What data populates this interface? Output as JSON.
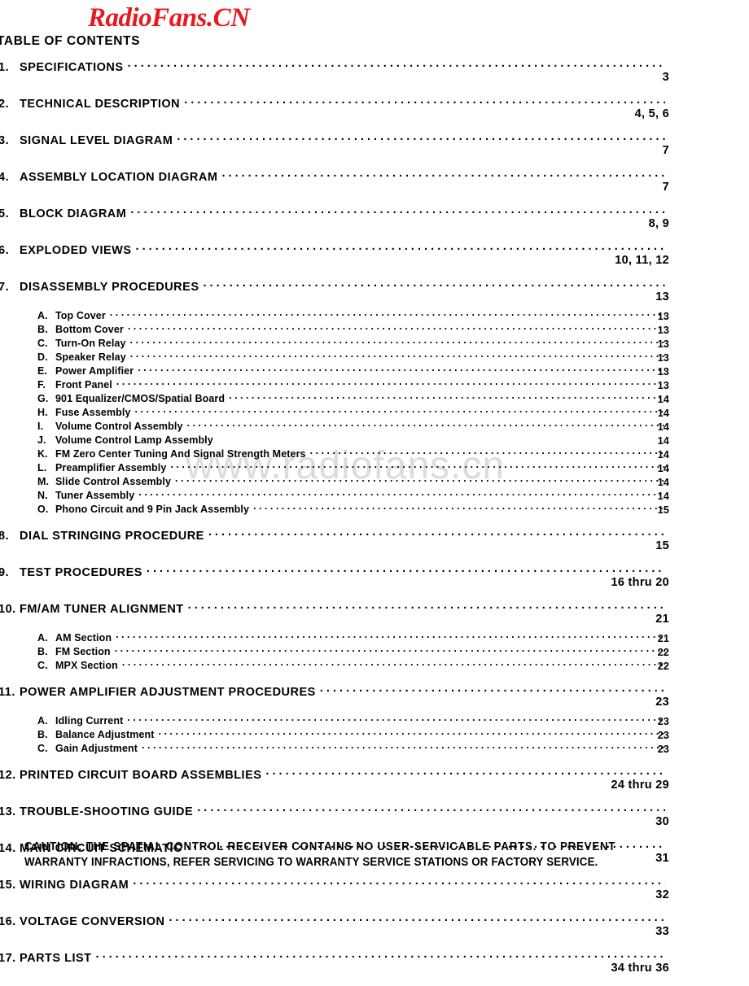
{
  "logo": {
    "text": "RadioFans.CN",
    "color": "#e8191e"
  },
  "watermark": {
    "text": "www.radiofans.cn",
    "color": "#dcdcdc"
  },
  "heading": "TABLE OF CONTENTS",
  "entries": [
    {
      "num": "1.",
      "label": "SPECIFICATIONS",
      "pages": "3",
      "level": "major",
      "leader": true,
      "gap": "md"
    },
    {
      "num": "2.",
      "label": "TECHNICAL DESCRIPTION",
      "pages": "4, 5, 6",
      "level": "major",
      "leader": true,
      "gap": "md"
    },
    {
      "num": "3.",
      "label": "SIGNAL LEVEL DIAGRAM",
      "pages": "7",
      "level": "major",
      "leader": true,
      "gap": "md"
    },
    {
      "num": "4.",
      "label": "ASSEMBLY LOCATION DIAGRAM",
      "pages": "7",
      "level": "major",
      "leader": true,
      "gap": "md"
    },
    {
      "num": "5.",
      "label": "BLOCK DIAGRAM",
      "pages": "8, 9",
      "level": "major",
      "leader": true,
      "gap": "md"
    },
    {
      "num": "6.",
      "label": "EXPLODED VIEWS",
      "pages": "10, 11, 12",
      "level": "major",
      "leader": true,
      "gap": "md"
    },
    {
      "num": "7.",
      "label": "DISASSEMBLY PROCEDURES",
      "pages": "13",
      "level": "major",
      "leader": true,
      "gap": "sm"
    },
    {
      "num": "A.",
      "label": "Top Cover",
      "pages": "13",
      "level": "sub",
      "leader": true
    },
    {
      "num": "B.",
      "label": "Bottom Cover",
      "pages": "13",
      "level": "sub",
      "leader": true
    },
    {
      "num": "C.",
      "label": "Turn-On Relay",
      "pages": "13",
      "level": "sub",
      "leader": true
    },
    {
      "num": "D.",
      "label": "Speaker Relay",
      "pages": "13",
      "level": "sub",
      "leader": true
    },
    {
      "num": "E.",
      "label": "Power Amplifier",
      "pages": "13",
      "level": "sub",
      "leader": true
    },
    {
      "num": "F.",
      "label": "Front Panel",
      "pages": "13",
      "level": "sub",
      "leader": true
    },
    {
      "num": "G.",
      "label": "901 Equalizer/CMOS/Spatial Board",
      "pages": "14",
      "level": "sub",
      "leader": true
    },
    {
      "num": "H.",
      "label": "Fuse Assembly",
      "pages": "14",
      "level": "sub",
      "leader": true
    },
    {
      "num": "I.",
      "label": "Volume Control Assembly",
      "pages": "14",
      "level": "sub",
      "leader": true
    },
    {
      "num": "J.",
      "label": "Volume Control Lamp Assembly",
      "pages": "14",
      "level": "sub",
      "leader": false
    },
    {
      "num": "K.",
      "label": "FM Zero Center Tuning And Signal Strength Meters",
      "pages": "14",
      "level": "sub",
      "leader": true
    },
    {
      "num": "L.",
      "label": "Preamplifier Assembly",
      "pages": "14",
      "level": "sub",
      "leader": true
    },
    {
      "num": "M.",
      "label": "Slide Control Assembly",
      "pages": "14",
      "level": "sub",
      "leader": true
    },
    {
      "num": "N.",
      "label": "Tuner Assembly",
      "pages": "14",
      "level": "sub",
      "leader": true
    },
    {
      "num": "O.",
      "label": "Phono Circuit and 9 Pin Jack Assembly",
      "pages": "15",
      "level": "sub",
      "leader": true,
      "gap": "md"
    },
    {
      "num": "8.",
      "label": "DIAL STRINGING PROCEDURE",
      "pages": "15",
      "level": "major",
      "leader": true,
      "gap": "md"
    },
    {
      "num": "9.",
      "label": "TEST PROCEDURES",
      "pages": "16 thru 20",
      "level": "major",
      "leader": true,
      "gap": "md"
    },
    {
      "num": "10.",
      "label": "FM/AM TUNER ALIGNMENT",
      "pages": "21",
      "level": "major",
      "leader": true,
      "gap": "sm"
    },
    {
      "num": "A.",
      "label": "AM Section",
      "pages": "21",
      "level": "sub",
      "leader": true
    },
    {
      "num": "B.",
      "label": "FM Section",
      "pages": "22",
      "level": "sub",
      "leader": true
    },
    {
      "num": "C.",
      "label": "MPX Section",
      "pages": "22",
      "level": "sub",
      "leader": true,
      "gap": "md"
    },
    {
      "num": "11.",
      "label": "POWER AMPLIFIER ADJUSTMENT PROCEDURES",
      "pages": "23",
      "level": "major",
      "leader": true,
      "gap": "sm"
    },
    {
      "num": "A.",
      "label": "Idling Current",
      "pages": "23",
      "level": "sub",
      "leader": true
    },
    {
      "num": "B.",
      "label": "Balance Adjustment",
      "pages": "23",
      "level": "sub",
      "leader": true
    },
    {
      "num": "C.",
      "label": "Gain Adjustment",
      "pages": "23",
      "level": "sub",
      "leader": true,
      "gap": "md"
    },
    {
      "num": "12.",
      "label": "PRINTED CIRCUIT BOARD ASSEMBLIES",
      "pages": "24 thru 29",
      "level": "major",
      "leader": true,
      "gap": "md"
    },
    {
      "num": "13.",
      "label": "TROUBLE-SHOOTING GUIDE",
      "pages": "30",
      "level": "major",
      "leader": true,
      "gap": "md"
    },
    {
      "num": "14.",
      "label": "MAIN CIRCUIT SCHEMATIC",
      "pages": "31",
      "level": "major",
      "leader": true,
      "gap": "md"
    },
    {
      "num": "15.",
      "label": "WIRING DIAGRAM",
      "pages": "32",
      "level": "major",
      "leader": true,
      "gap": "md"
    },
    {
      "num": "16.",
      "label": "VOLTAGE CONVERSION",
      "pages": "33",
      "level": "major",
      "leader": true,
      "gap": "md"
    },
    {
      "num": "17.",
      "label": "PARTS LIST",
      "pages": "34 thru 36",
      "level": "major",
      "leader": true,
      "gap": "md"
    }
  ],
  "caution": {
    "line1": "CAUTION: THE SPATIAL CONTROL RECEIVER CONTAINS NO USER-SERVICABLE PARTS. TO PREVENT",
    "line2": "WARRANTY INFRACTIONS, REFER SERVICING TO WARRANTY SERVICE STATIONS OR FACTORY SERVICE."
  }
}
